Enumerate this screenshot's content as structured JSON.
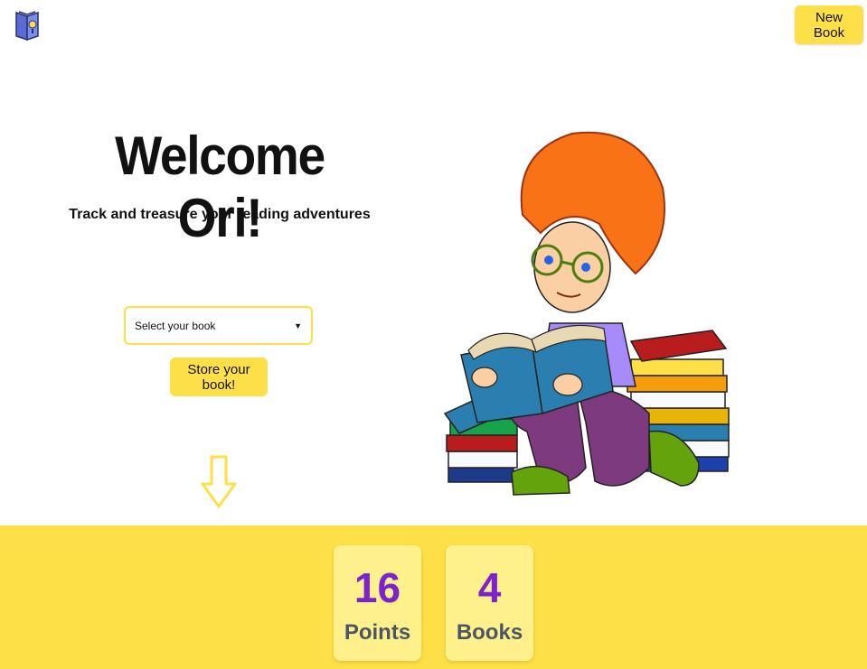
{
  "header": {
    "logo_icon": "book-icon",
    "new_book_label": "New Book"
  },
  "hero": {
    "title": "Welcome Ori!",
    "subtitle": "Track and treasure your reading adventures"
  },
  "form": {
    "select_value": "Select your book",
    "store_label": "Store your book!"
  },
  "stats": [
    {
      "value": "16",
      "label": "Points"
    },
    {
      "value": "4",
      "label": "Books"
    }
  ],
  "colors": {
    "accent": "#fde047",
    "card": "#fef08a",
    "stat_value": "#7e22ce",
    "stat_label": "#4b5563"
  }
}
